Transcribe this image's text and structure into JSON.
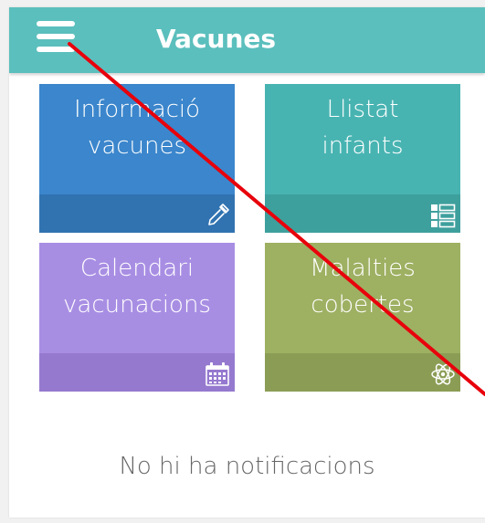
{
  "app": {
    "title": "Vacunes"
  },
  "tiles": [
    {
      "id": "informacio",
      "line1": "Informació",
      "line2": "vacunes",
      "icon": "dropper-icon",
      "color": "#3b86cc",
      "footer": "#3173b1"
    },
    {
      "id": "llistat",
      "line1": "Llistat",
      "line2": "infants",
      "icon": "list-icon",
      "color": "#48b4b2",
      "footer": "#3ea09d"
    },
    {
      "id": "calendari",
      "line1": "Calendari",
      "line2": "vacunacions",
      "icon": "calendar-icon",
      "color": "#a88ee3",
      "footer": "#9579cf"
    },
    {
      "id": "malalties",
      "line1": "Malalties",
      "line2": "cobertes",
      "icon": "atom-icon",
      "color": "#9eb062",
      "footer": "#8b9d55"
    }
  ],
  "notifications": {
    "empty_text": "No hi ha notificacions"
  },
  "overlay": {
    "line_color": "#e8000b"
  }
}
